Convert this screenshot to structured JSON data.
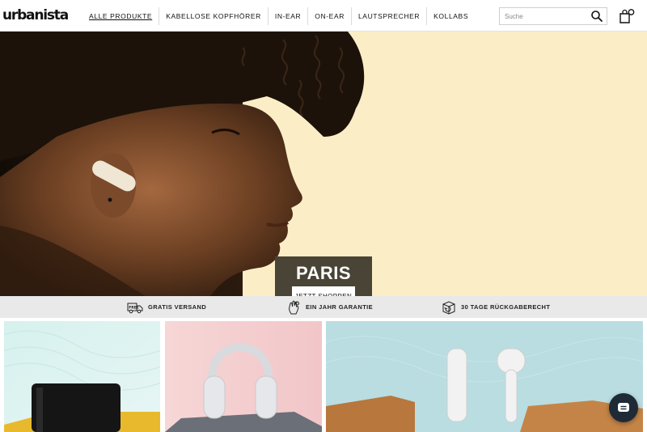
{
  "brand": {
    "logo": "urbanista"
  },
  "nav": {
    "items": [
      {
        "label": "ALLE PRODUKTE",
        "active": true
      },
      {
        "label": "KABELLOSE KOPFHÖRER",
        "active": false
      },
      {
        "label": "IN-EAR",
        "active": false
      },
      {
        "label": "ON-EAR",
        "active": false
      },
      {
        "label": "LAUTSPRECHER",
        "active": false
      },
      {
        "label": "KOLLABS",
        "active": false
      }
    ]
  },
  "search": {
    "placeholder": "Suche",
    "value": "",
    "icon": "search-icon"
  },
  "cart": {
    "icon": "shopping-bag-icon"
  },
  "hero": {
    "title": "PARIS",
    "cta_label": "JETZT SHOPPEN",
    "background_color": "#fbeec7",
    "panel_color": "#4a4436"
  },
  "usp": {
    "items": [
      {
        "label": "GRATIS VERSAND",
        "icon": "free-shipping-truck-icon",
        "icon_text": "FREE"
      },
      {
        "label": "EIN JAHR GARANTIE",
        "icon": "hand-ok-icon"
      },
      {
        "label": "30 TAGE RÜCKGABERECHT",
        "icon": "return-box-icon"
      }
    ]
  },
  "tiles": [
    {
      "product": "speaker",
      "icon": "speaker-image"
    },
    {
      "product": "headphones",
      "icon": "headphones-image"
    },
    {
      "product": "earbuds",
      "icon": "earbuds-image"
    }
  ],
  "chat": {
    "icon": "chat-icon"
  }
}
